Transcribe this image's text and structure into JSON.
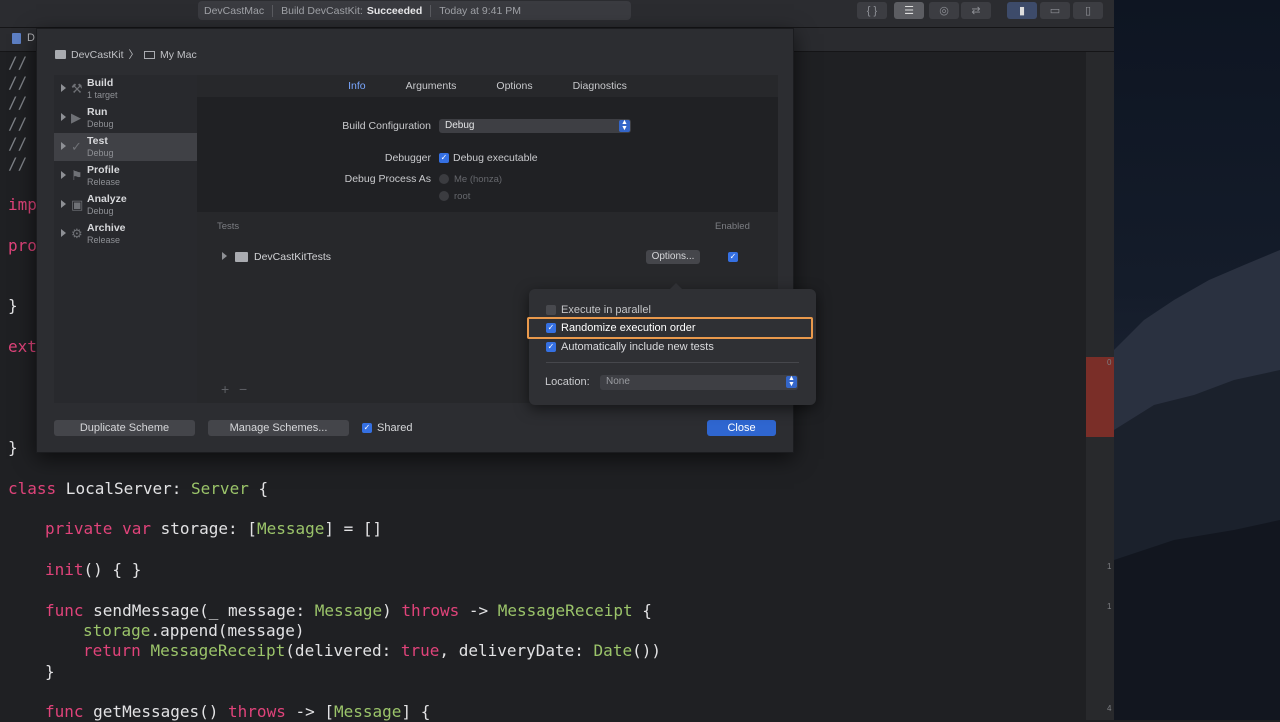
{
  "toolbar": {
    "scheme": "DevCastMac",
    "status_prefix": "Build DevCastKit:",
    "status_result": "Succeeded",
    "timestamp": "Today at 9:41 PM"
  },
  "editor": {
    "tab_title": "D",
    "lines": {
      "c1": "//",
      "c2": "//",
      "c3": "//",
      "c4": "//",
      "c5": "//",
      "c6": "//",
      "imp": "imp",
      "pro": "pro",
      "brace1": "}",
      "ext": "ext",
      "brace2": "}",
      "class_kw": "class",
      "class_name": " LocalServer: ",
      "class_type": "Server",
      "class_tail": " {",
      "priv_kw": "private var",
      "priv_mid": " storage: [",
      "priv_type": "Message",
      "priv_tail": "] = []",
      "init_kw": "init",
      "init_tail": "() { }",
      "func_kw": "func",
      "send_mid": " sendMessage(_ message: ",
      "send_type": "Message",
      "throws_kw": "throws",
      "arrow": " -> ",
      "receipt_type": "MessageReceipt",
      "send_tail": " {",
      "storage_ref": "storage",
      "append_tail": ".append(message)",
      "return_kw": "return",
      "receipt_type2": "MessageReceipt",
      "deliv_mid": "(delivered: ",
      "true_kw": "true",
      "deliv_tail": ", deliveryDate: ",
      "date_type": "Date",
      "date_tail": "())",
      "brace3": "}",
      "func_kw2": "func",
      "get_mid": " getMessages() ",
      "throws_kw2": "throws",
      "arrow2": " -> [",
      "msg_type": "Message",
      "get_tail": "] {"
    },
    "minimap_numbers": [
      "0",
      "1",
      "1",
      "4"
    ]
  },
  "sheet": {
    "breadcrumb": {
      "project": "DevCastKit",
      "destination": "My Mac"
    },
    "actions": [
      {
        "name": "Build",
        "sub": "1 target"
      },
      {
        "name": "Run",
        "sub": "Debug"
      },
      {
        "name": "Test",
        "sub": "Debug"
      },
      {
        "name": "Profile",
        "sub": "Release"
      },
      {
        "name": "Analyze",
        "sub": "Debug"
      },
      {
        "name": "Archive",
        "sub": "Release"
      }
    ],
    "tabs": [
      "Info",
      "Arguments",
      "Options",
      "Diagnostics"
    ],
    "info": {
      "build_config_label": "Build Configuration",
      "build_config_value": "Debug",
      "debugger_label": "Debugger",
      "debug_exec_label": "Debug executable",
      "debug_process_label": "Debug Process As",
      "radio_me": "Me (honza)",
      "radio_root": "root"
    },
    "tests": {
      "header_tests": "Tests",
      "header_enabled": "Enabled",
      "bundle_name": "DevCastKitTests",
      "options_button": "Options...",
      "add": "+",
      "remove": "−"
    },
    "footer": {
      "duplicate": "Duplicate Scheme",
      "manage": "Manage Schemes...",
      "shared": "Shared",
      "close": "Close"
    }
  },
  "popover": {
    "parallel": "Execute in parallel",
    "randomize": "Randomize execution order",
    "auto_include": "Automatically include new tests",
    "location_label": "Location:",
    "location_value": "None"
  }
}
